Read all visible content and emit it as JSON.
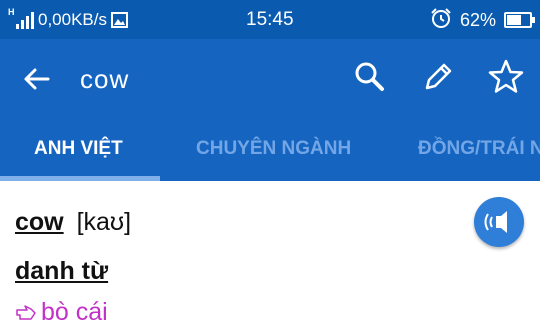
{
  "status_bar": {
    "network_type": "H",
    "net_speed": "0,00KB/s",
    "time": "15:45",
    "battery_percent_text": "62%",
    "battery_level": 0.62
  },
  "app_bar": {
    "query": "cow",
    "icons": [
      "back-arrow-icon",
      "search-icon",
      "pencil-icon",
      "star-icon"
    ]
  },
  "tabs": [
    {
      "label": "ANH VIỆT",
      "active": true
    },
    {
      "label": "CHUYÊN NGÀNH",
      "active": false
    },
    {
      "label": "ĐỒNG/TRÁI NGHĨA",
      "active": false
    }
  ],
  "entry": {
    "headword": "cow",
    "pronunciation": "[kaʊ]",
    "part_of_speech": "danh từ",
    "meanings": [
      "bò cái"
    ]
  },
  "colors": {
    "status_bar": "#0a5bb0",
    "app_bar": "#1565c0",
    "tab_inactive": "#73a6e6",
    "meaning": "#c232c9",
    "speaker_button": "#2f7ed8"
  }
}
